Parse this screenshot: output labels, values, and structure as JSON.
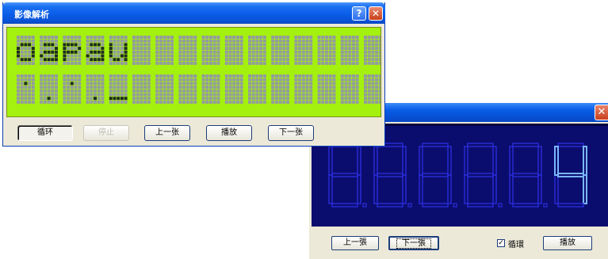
{
  "colors": {
    "lcd_bg": "#a4f00e",
    "lcd_dot_off": "#939ba0",
    "lcd_dot_on": "#1f2a24",
    "seg_bg": "#0b0d6e",
    "seg_off": "#2a2cd9",
    "seg_on": "#7ab6ff"
  },
  "dot_matrix_window": {
    "title": "影像解析",
    "help_icon": "help-icon",
    "close_icon": "close-icon",
    "top_row_text": "oapau",
    "bottom_row_text": "._._-",
    "buttons": {
      "loop": "循环",
      "stop": "停止",
      "prev": "上一张",
      "play": "播放",
      "next": "下一张"
    }
  },
  "segment_window": {
    "title_fragment": ")",
    "close_icon": "close-icon",
    "digits": [
      "8",
      "8",
      "8",
      "8",
      "8",
      "4"
    ],
    "lit_digit": "4",
    "buttons": {
      "prev": "上一張",
      "next": "下一張",
      "loop_label": "循環",
      "loop_checked": true,
      "play": "播放"
    }
  }
}
